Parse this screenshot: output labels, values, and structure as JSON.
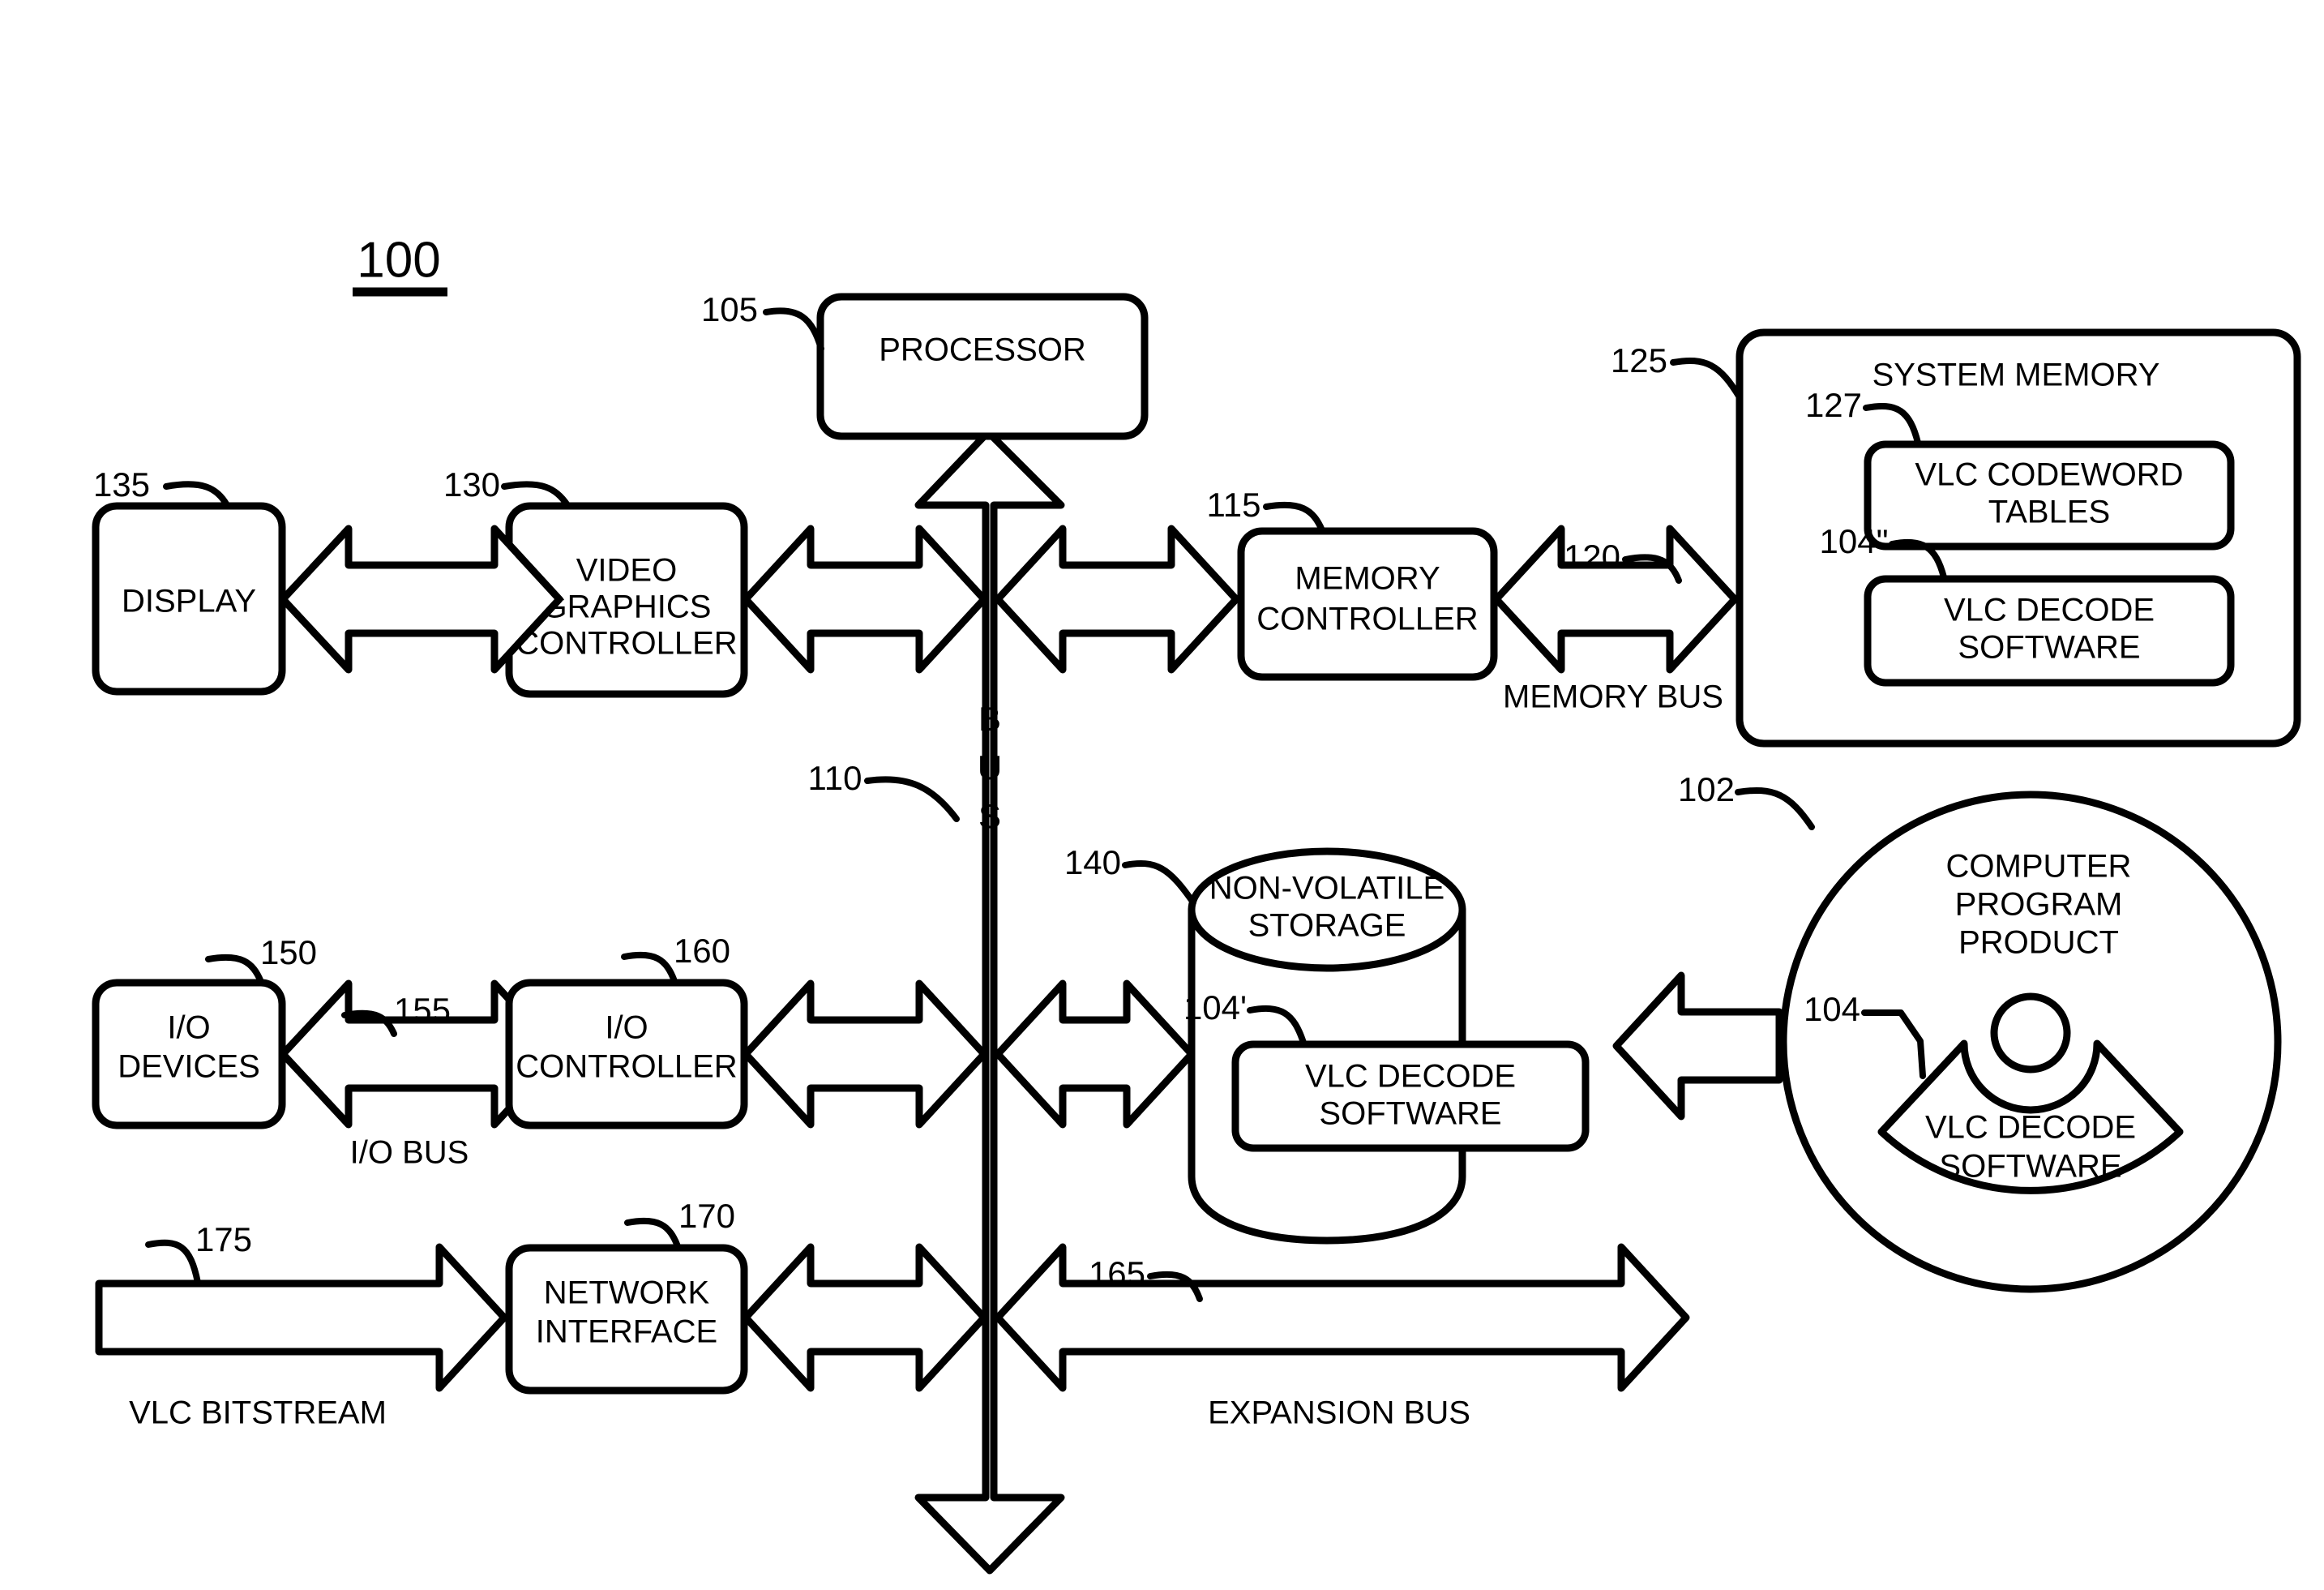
{
  "figure": {
    "number": "100",
    "caption_underline": true
  },
  "blocks": {
    "processor": {
      "ref": "105",
      "label": "PROCESSOR"
    },
    "display": {
      "ref": "135",
      "label": "DISPLAY"
    },
    "video_graphics": {
      "ref": "130",
      "label_line1": "VIDEO",
      "label_line2": "GRAPHICS",
      "label_line3": "CONTROLLER"
    },
    "memory_controller": {
      "ref": "115",
      "label_line1": "MEMORY",
      "label_line2": "CONTROLLER"
    },
    "system_memory": {
      "ref": "125",
      "label": "SYSTEM MEMORY"
    },
    "vlc_codeword_tables": {
      "ref": "127",
      "label_line1": "VLC CODEWORD",
      "label_line2": "TABLES"
    },
    "vlc_decode_sw_memory": {
      "ref": "104\"",
      "label_line1": "VLC DECODE",
      "label_line2": "SOFTWARE"
    },
    "nonvolatile_storage": {
      "ref": "140",
      "label_line1": "NON-VOLATILE",
      "label_line2": "STORAGE"
    },
    "vlc_decode_sw_storage": {
      "ref": "104'",
      "label_line1": "VLC DECODE",
      "label_line2": "SOFTWARE"
    },
    "computer_program_product": {
      "ref": "102",
      "label_line1": "COMPUTER",
      "label_line2": "PROGRAM",
      "label_line3": "PRODUCT"
    },
    "vlc_decode_sw_disc": {
      "ref": "104",
      "label_line1": "VLC DECODE",
      "label_line2": "SOFTWARE"
    },
    "io_devices": {
      "ref": "150",
      "label_line1": "I/O",
      "label_line2": "DEVICES"
    },
    "io_controller": {
      "ref": "160",
      "label_line1": "I/O",
      "label_line2": "CONTROLLER"
    },
    "network_interface": {
      "ref": "170",
      "label_line1": "NETWORK",
      "label_line2": "INTERFACE"
    }
  },
  "buses": {
    "main_bus": {
      "ref": "110",
      "letters": [
        "B",
        "U",
        "S"
      ]
    },
    "memory_bus": {
      "ref": "120",
      "label": "MEMORY BUS"
    },
    "io_bus": {
      "ref": "155",
      "label": "I/O BUS"
    },
    "expansion_bus": {
      "ref": "165",
      "label": "EXPANSION BUS"
    },
    "vlc_bitstream": {
      "ref": "175",
      "label": "VLC BITSTREAM"
    }
  },
  "colors": {
    "ink": "#000000",
    "paper": "#ffffff"
  }
}
